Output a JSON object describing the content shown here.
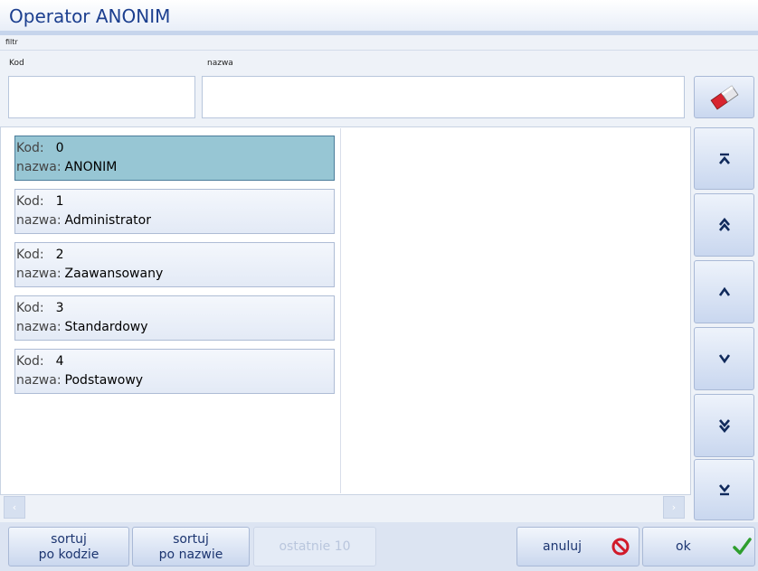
{
  "window": {
    "title": "Operator ANONIM"
  },
  "filter": {
    "label": "filtr",
    "kod_label": "Kod",
    "nazwa_label": "nazwa",
    "kod_value": "",
    "nazwa_value": ""
  },
  "list": {
    "kod_label": "Kod:",
    "nazwa_label": "nazwa:",
    "items": [
      {
        "kod": "0",
        "nazwa": "ANONIM"
      },
      {
        "kod": "1",
        "nazwa": "Administrator"
      },
      {
        "kod": "2",
        "nazwa": "Zaawansowany"
      },
      {
        "kod": "3",
        "nazwa": "Standardowy"
      },
      {
        "kod": "4",
        "nazwa": "Podstawowy"
      }
    ],
    "selected_index": 0
  },
  "nav": {
    "first": "⊼",
    "page_up": "»",
    "up": "^",
    "down": "v",
    "page_down": "»",
    "last": "⊻"
  },
  "scroll": {
    "left": "‹",
    "right": "›"
  },
  "bottom": {
    "sort_code_line1": "sortuj",
    "sort_code_line2": "po kodzie",
    "sort_name_line1": "sortuj",
    "sort_name_line2": "po nazwie",
    "last10": "ostatnie 10",
    "cancel": "anuluj",
    "ok": "ok"
  },
  "colors": {
    "title": "#1c3f8f",
    "selected_item": "#97c6d4",
    "cancel_icon": "#d11a2a",
    "ok_icon": "#2e9e2e"
  },
  "icons": {
    "eraser": "eraser-icon",
    "cancel": "no-entry-icon",
    "ok": "checkmark-icon"
  }
}
